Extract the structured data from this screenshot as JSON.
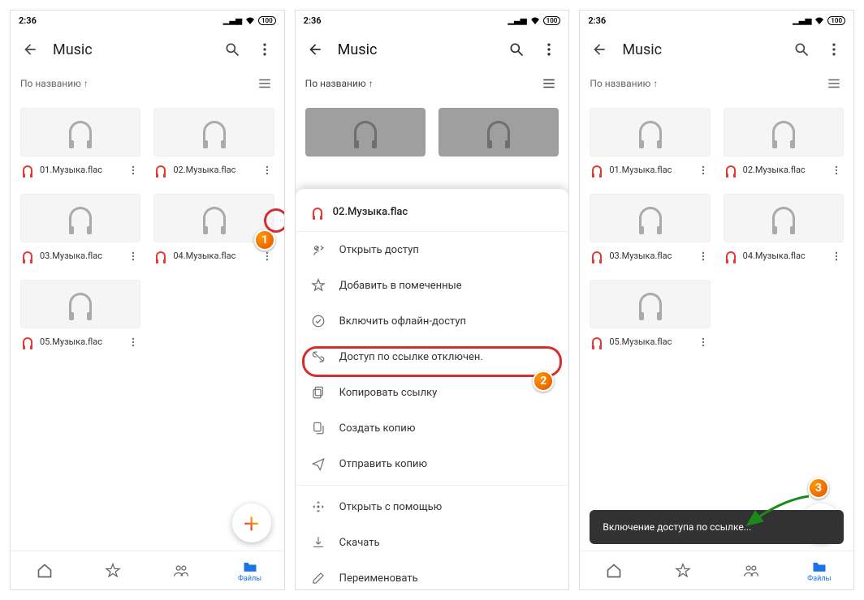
{
  "status_time": "2:36",
  "status_battery": "100",
  "title": "Music",
  "sort_label": "По названию ↑",
  "nav_files_label": "Файлы",
  "files": [
    {
      "name": "01.Музыка.flac"
    },
    {
      "name": "02.Музыка.flac"
    },
    {
      "name": "03.Музыка.flac"
    },
    {
      "name": "04.Музыка.flac"
    },
    {
      "name": "05.Музыка.flac"
    }
  ],
  "sheet_file": "02.Музыка.flac",
  "sheet_items": [
    {
      "icon": "share",
      "label": "Открыть доступ"
    },
    {
      "icon": "star",
      "label": "Добавить в помеченные"
    },
    {
      "icon": "offline",
      "label": "Включить офлайн-доступ"
    },
    {
      "icon": "link-off",
      "label": "Доступ по ссылке отключен."
    },
    {
      "icon": "copy-link",
      "label": "Копировать ссылку"
    },
    {
      "icon": "copy",
      "label": "Создать копию"
    },
    {
      "icon": "send",
      "label": "Отправить копию"
    },
    {
      "icon": "open-with",
      "label": "Открыть с помощью"
    },
    {
      "icon": "download",
      "label": "Скачать"
    },
    {
      "icon": "rename",
      "label": "Переименовать"
    }
  ],
  "toast_text": "Включение доступа по ссылке...",
  "callouts": {
    "c1": "1",
    "c2": "2",
    "c3": "3"
  },
  "colors": {
    "accent": "#1a73e8",
    "ring": "#d32f2f"
  }
}
